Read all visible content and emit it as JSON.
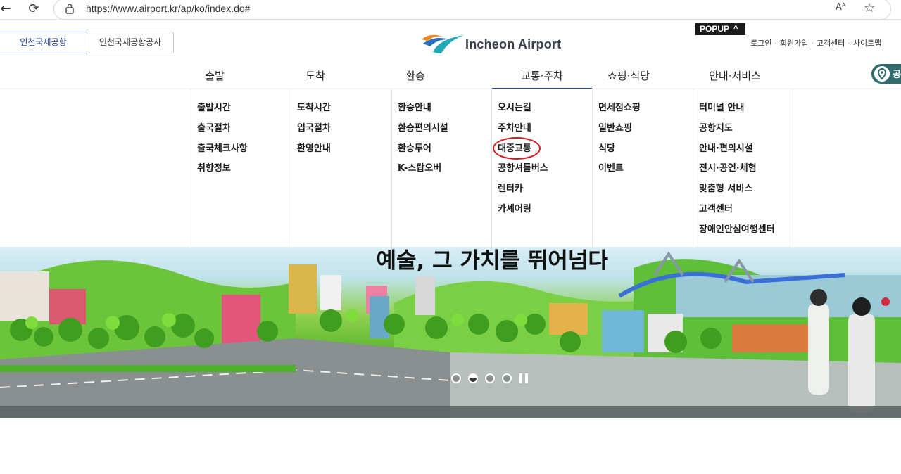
{
  "browser": {
    "url": "https://www.airport.kr/ap/ko/index.do#",
    "read_aloud": "Aᴬ",
    "back": "←",
    "refresh": "⟳",
    "favorite": "☆"
  },
  "header": {
    "corp_tabs": [
      "인천국제공항",
      "인천국제공항공사"
    ],
    "logo_text": "Incheon Airport",
    "popup_label": "POPUP",
    "popup_caret": "^",
    "util_links": [
      "로그인",
      "회원가입",
      "고객센터",
      "사이트맵"
    ],
    "search_partial": "공"
  },
  "gnb": {
    "items": [
      "출발",
      "도착",
      "환승",
      "교통·주차",
      "쇼핑·식당",
      "안내·서비스"
    ],
    "active_index": 3
  },
  "mega_menu": {
    "columns": [
      [
        "출발시간",
        "출국절차",
        "출국체크사항",
        "취항정보"
      ],
      [
        "도착시간",
        "입국절차",
        "환영안내"
      ],
      [
        "환승안내",
        "환승편의시설",
        "환승투어",
        "K-스탑오버"
      ],
      [
        "오시는길",
        "주차안내",
        "대중교통",
        "공항셔틀버스",
        "렌터카",
        "카셰어링"
      ],
      [
        "면세점쇼핑",
        "일반쇼핑",
        "식당",
        "이벤트"
      ],
      [
        "터미널 안내",
        "공항지도",
        "안내·편의시설",
        "전시·공연·체험",
        "맞춤형 서비스",
        "고객센터",
        "장애인안심여행센터"
      ]
    ],
    "highlighted": "대중교통"
  },
  "banner": {
    "title": "예술, 그 가치를 뛰어넘다",
    "slide_count": 4,
    "active_slide": 2
  },
  "colors": {
    "brand_blue": "#1d4fa3",
    "highlight_red": "#d11a22",
    "popup_bg": "#1b1b1b"
  }
}
